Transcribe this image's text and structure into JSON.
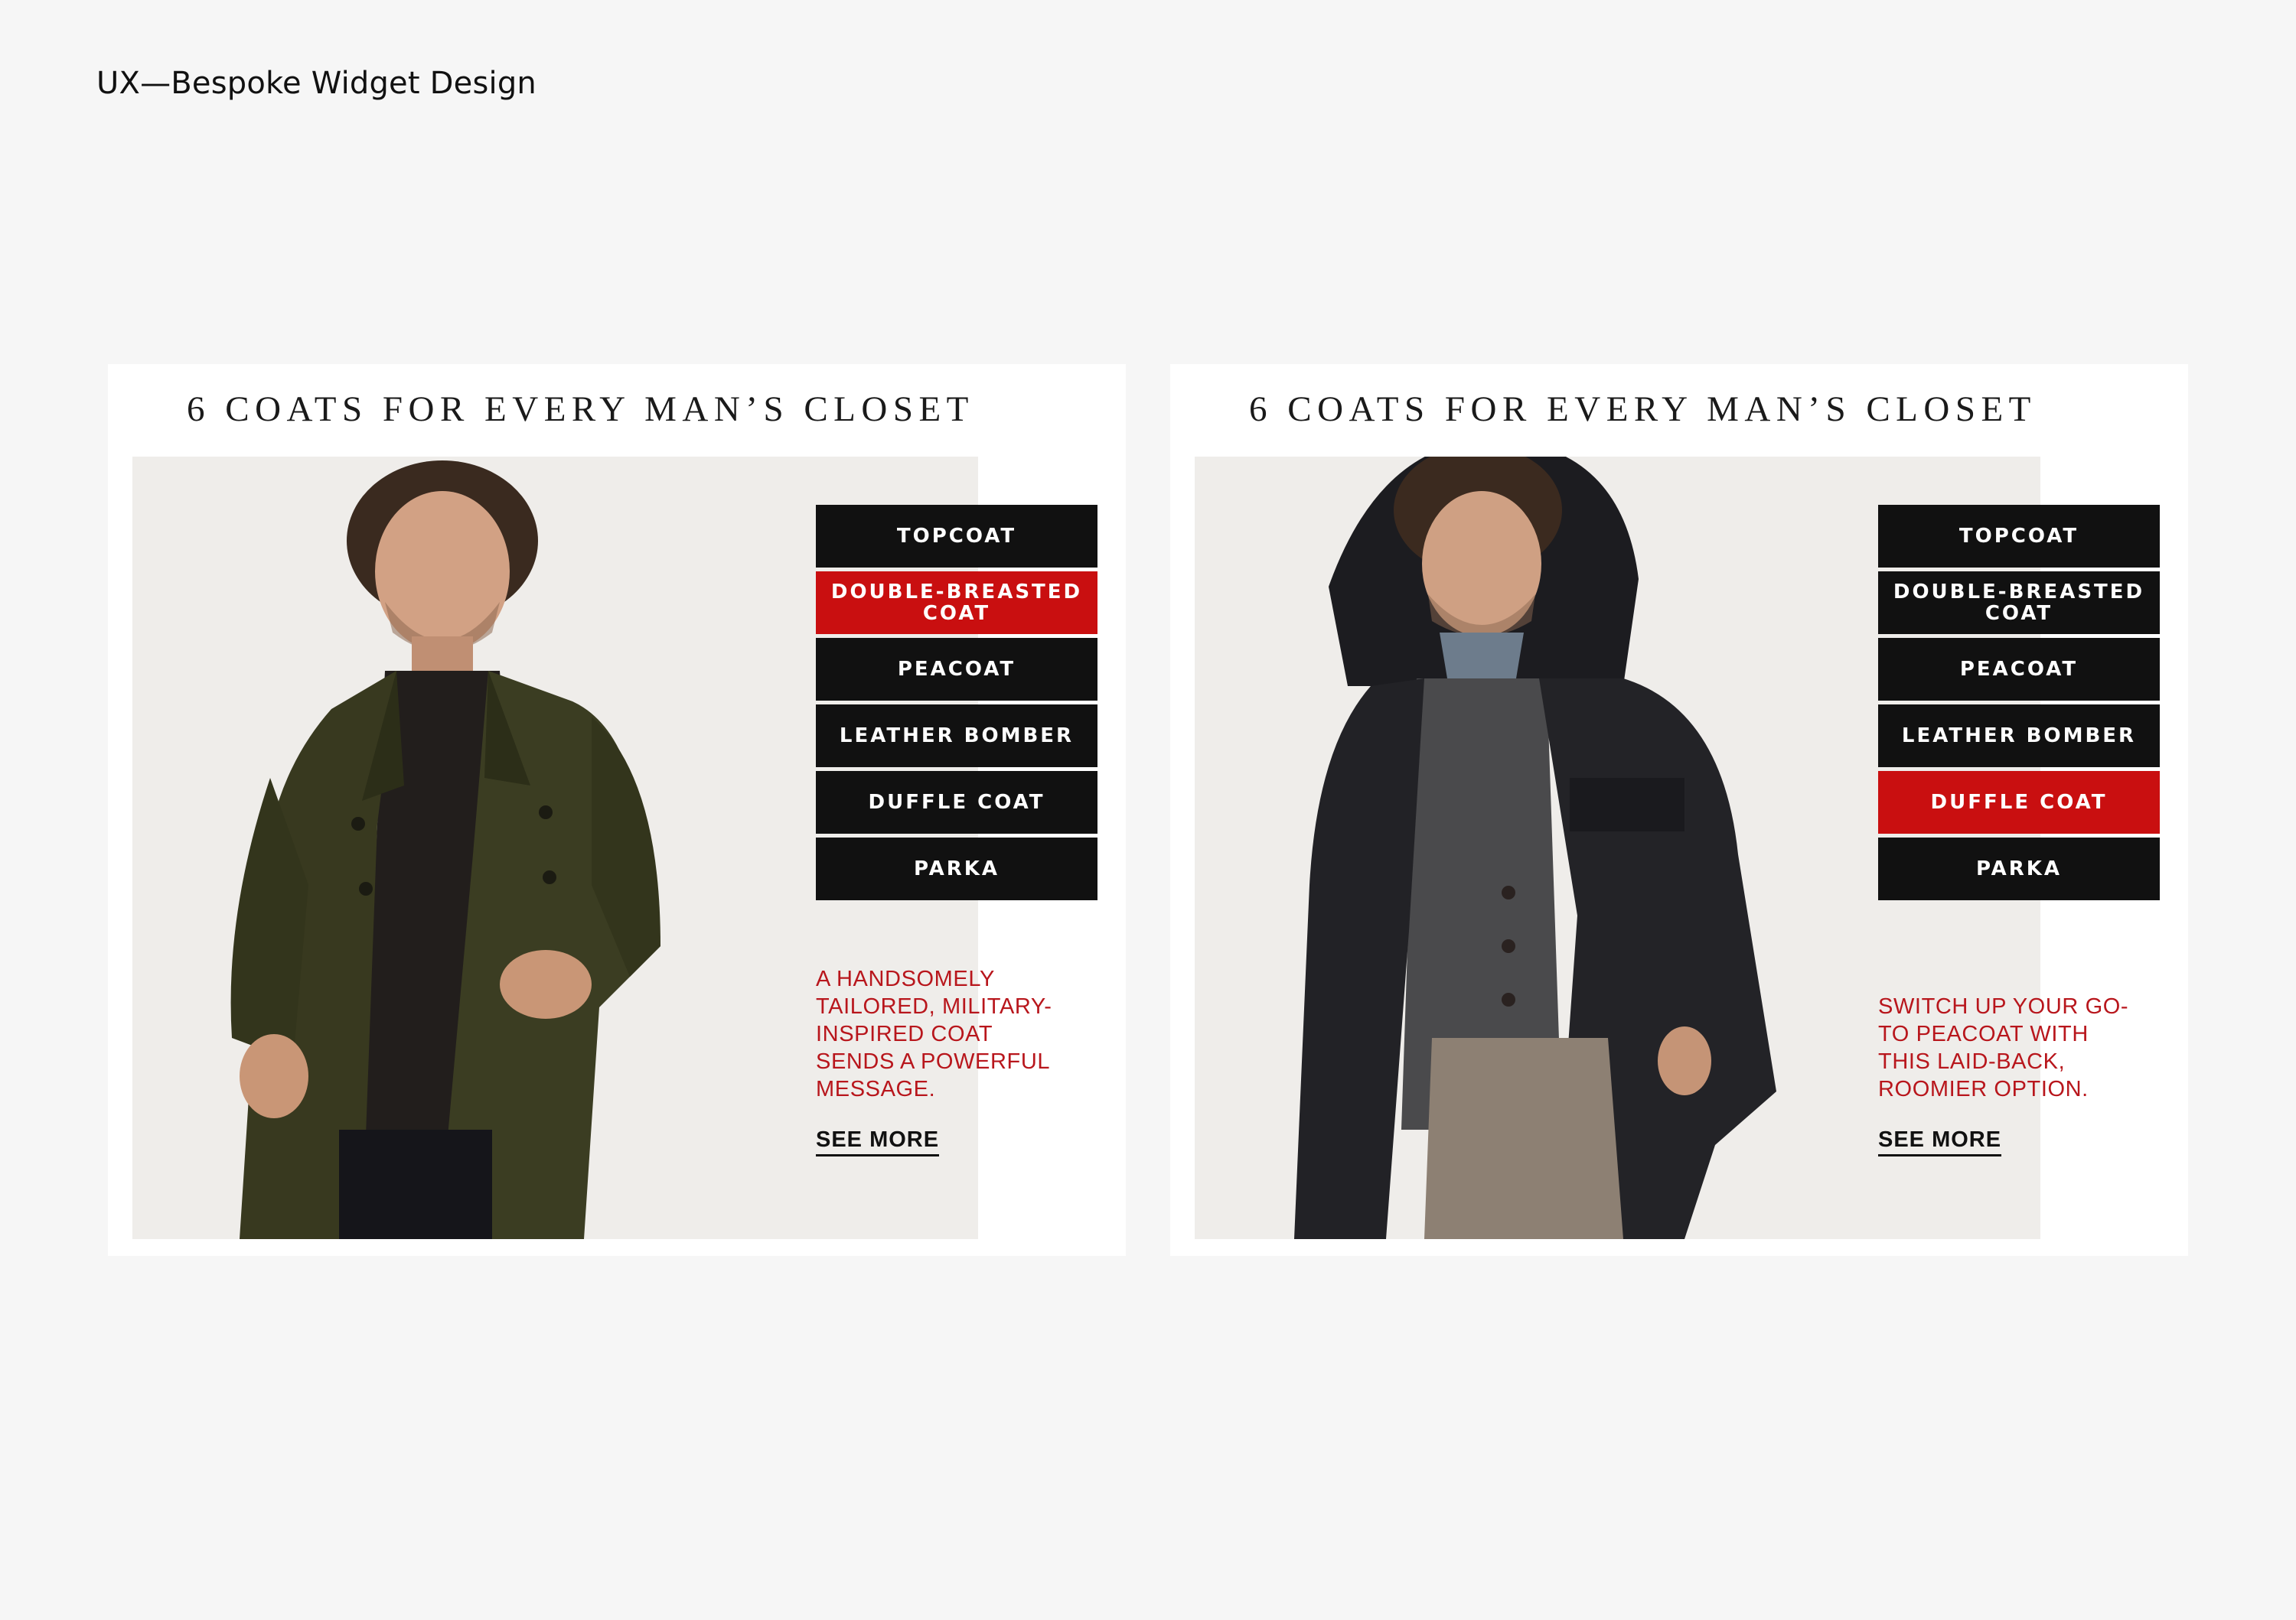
{
  "page": {
    "title": "UX—Bespoke Widget Design"
  },
  "cards": [
    {
      "heading": "6 COATS FOR EVERY MAN’S CLOSET",
      "menu": [
        "TOPCOAT",
        "DOUBLE-BREASTED COAT",
        "PEACOAT",
        "LEATHER BOMBER",
        "DUFFLE COAT",
        "PARKA"
      ],
      "active_item": "DOUBLE-BREASTED COAT",
      "description": "A HANDSOMELY TAILORED, MILITARY-INSPIRED COAT SENDS A POWERFUL MESSAGE.",
      "link": "SEE MORE"
    },
    {
      "heading": "6 COATS FOR EVERY MAN’S CLOSET",
      "menu": [
        "TOPCOAT",
        "DOUBLE-BREASTED COAT",
        "PEACOAT",
        "LEATHER BOMBER",
        "DUFFLE COAT",
        "PARKA"
      ],
      "active_item": "DUFFLE COAT",
      "description": "SWITCH UP YOUR GO-TO PEACOAT WITH THIS LAID-BACK, ROOMIER OPTION.",
      "link": "SEE MORE"
    }
  ],
  "colors": {
    "background": "#f6f6f6",
    "card": "#ffffff",
    "photo_backdrop": "#efedea",
    "menu_item": "#111111",
    "menu_active": "#c90f10",
    "description_text": "#b8161c"
  }
}
